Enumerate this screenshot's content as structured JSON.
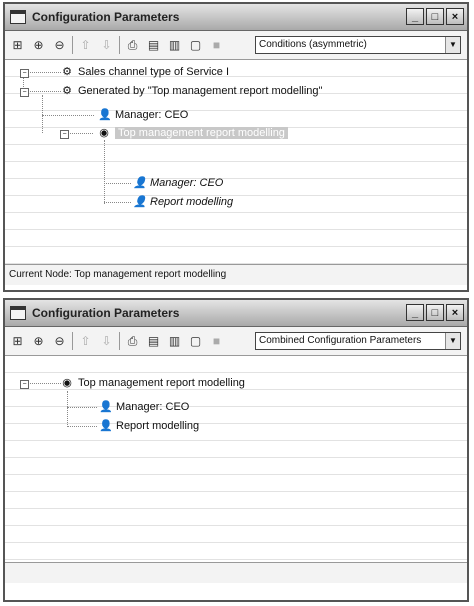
{
  "window1": {
    "title": "Configuration Parameters",
    "title_buttons": [
      "_",
      "□",
      "×"
    ],
    "combo_value": "Conditions (asymmetric)",
    "tree": {
      "node1": "Sales channel type of Service I",
      "node2": "Generated by \"Top management report modelling\"",
      "node3": "Manager: CEO",
      "node4": "Top management report modelling",
      "node5": "Manager: CEO",
      "node6": "Report modelling"
    },
    "status": "Current Node: Top management report modelling"
  },
  "window2": {
    "title": "Configuration Parameters",
    "title_buttons": [
      "_",
      "□",
      "×"
    ],
    "combo_value": "Combined Configuration Parameters",
    "tree": {
      "node1": "Top management report modelling",
      "node2": "Manager: CEO",
      "node3": "Report modelling"
    }
  },
  "toolbar_icons": [
    "tree-icon",
    "tree-add-icon",
    "tree-remove-icon",
    "arrow-up-icon",
    "arrow-down-icon",
    "print-icon",
    "print-preview-icon",
    "book-icon",
    "page-icon",
    "stop-icon"
  ]
}
